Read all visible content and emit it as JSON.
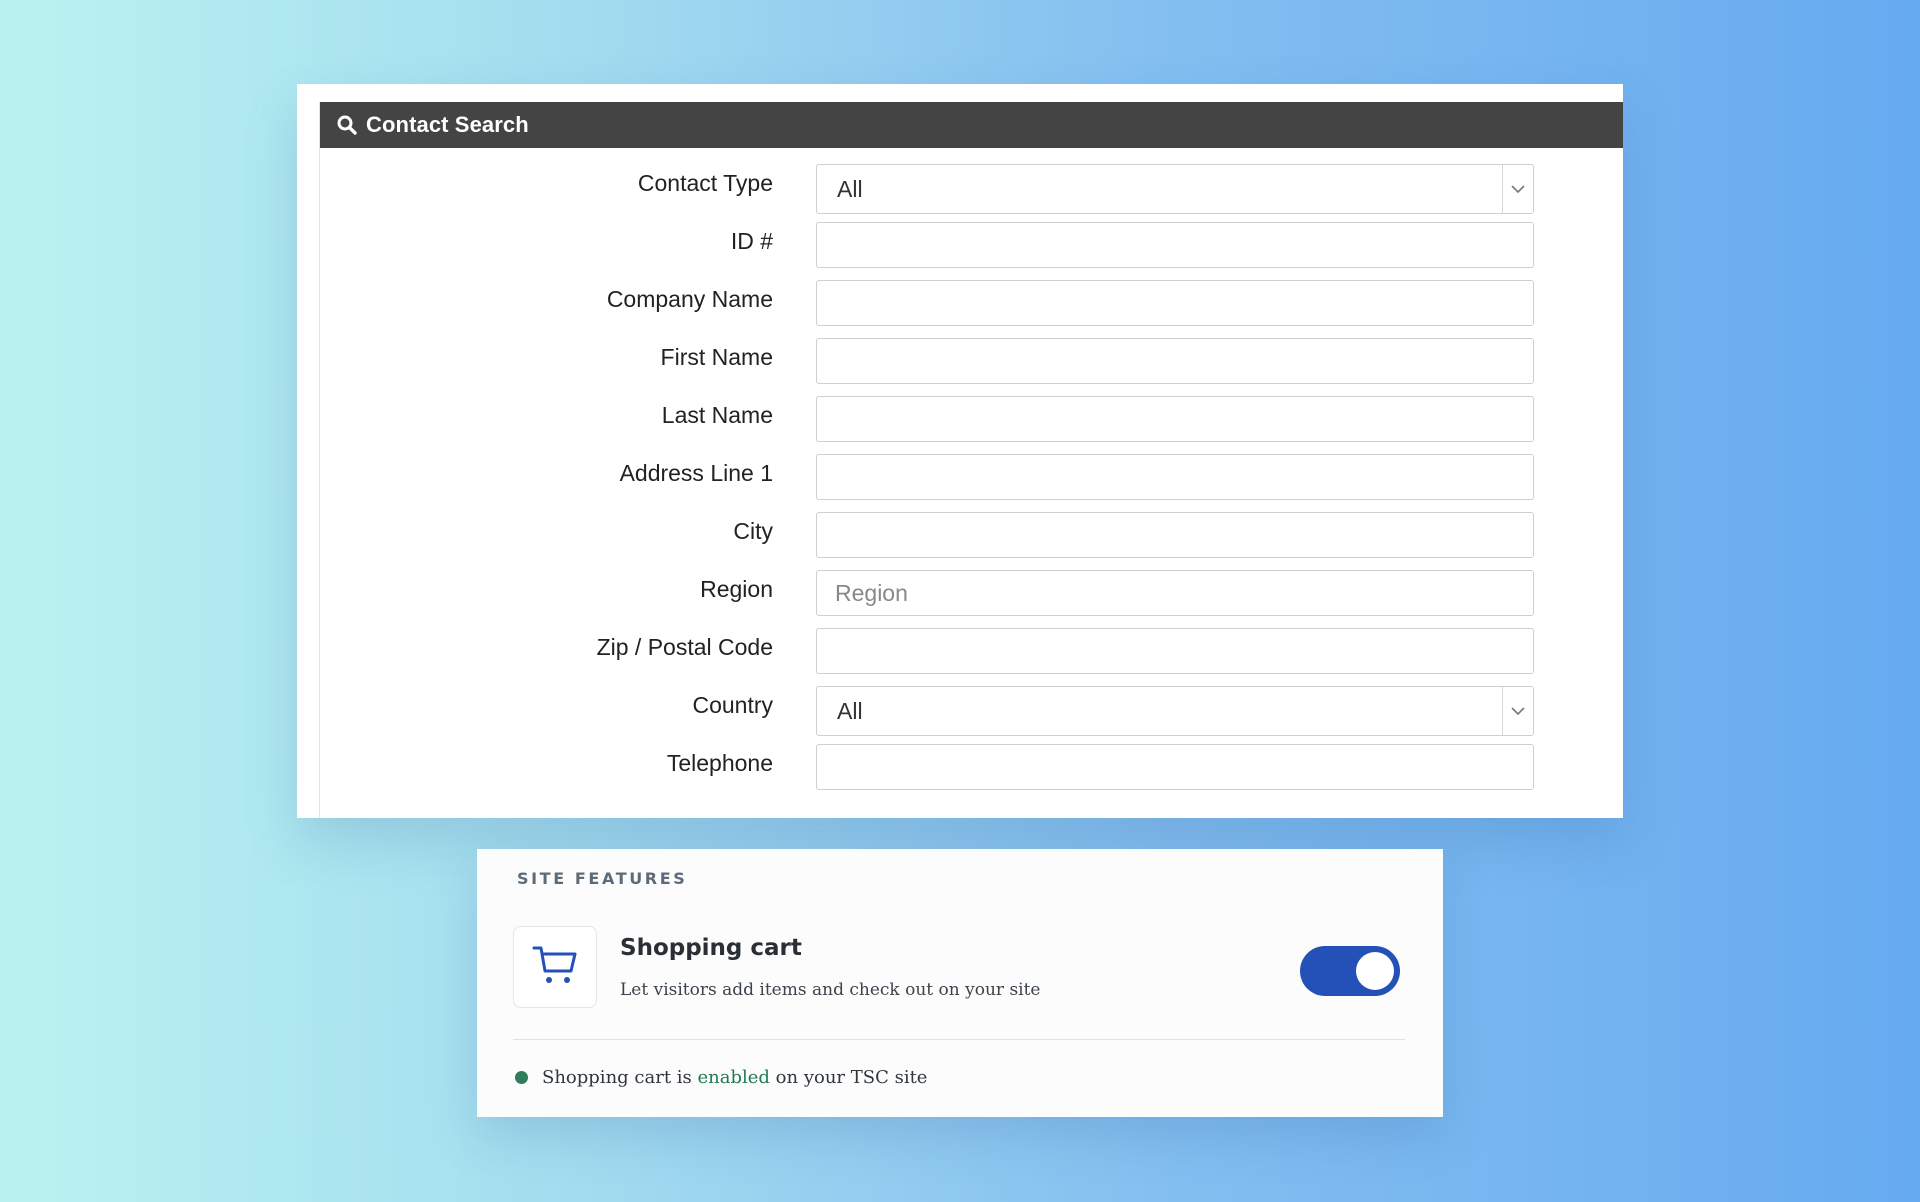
{
  "contact_search": {
    "title": "Contact Search",
    "header_icon": "search-icon",
    "fields": [
      {
        "label": "Contact Type",
        "type": "select",
        "value": "All"
      },
      {
        "label": "ID #",
        "type": "text",
        "value": ""
      },
      {
        "label": "Company Name",
        "type": "text",
        "value": ""
      },
      {
        "label": "First Name",
        "type": "text",
        "value": ""
      },
      {
        "label": "Last Name",
        "type": "text",
        "value": ""
      },
      {
        "label": "Address Line 1",
        "type": "text",
        "value": ""
      },
      {
        "label": "City",
        "type": "text",
        "value": ""
      },
      {
        "label": "Region",
        "type": "text",
        "value": "",
        "placeholder": "Region"
      },
      {
        "label": "Zip / Postal Code",
        "type": "text",
        "value": ""
      },
      {
        "label": "Country",
        "type": "select",
        "value": "All"
      },
      {
        "label": "Telephone",
        "type": "text",
        "value": ""
      }
    ]
  },
  "site_features": {
    "heading": "SITE FEATURES",
    "feature": {
      "icon": "shopping-cart-icon",
      "title": "Shopping cart",
      "description": "Let visitors add items and check out on your site",
      "enabled": true
    },
    "status": {
      "prefix": "Shopping cart is",
      "state": "enabled",
      "suffix": "on your TSC site"
    }
  },
  "colors": {
    "header_bg": "#444444",
    "toggle_on": "#2451b7",
    "status_green": "#1f7a4d"
  }
}
